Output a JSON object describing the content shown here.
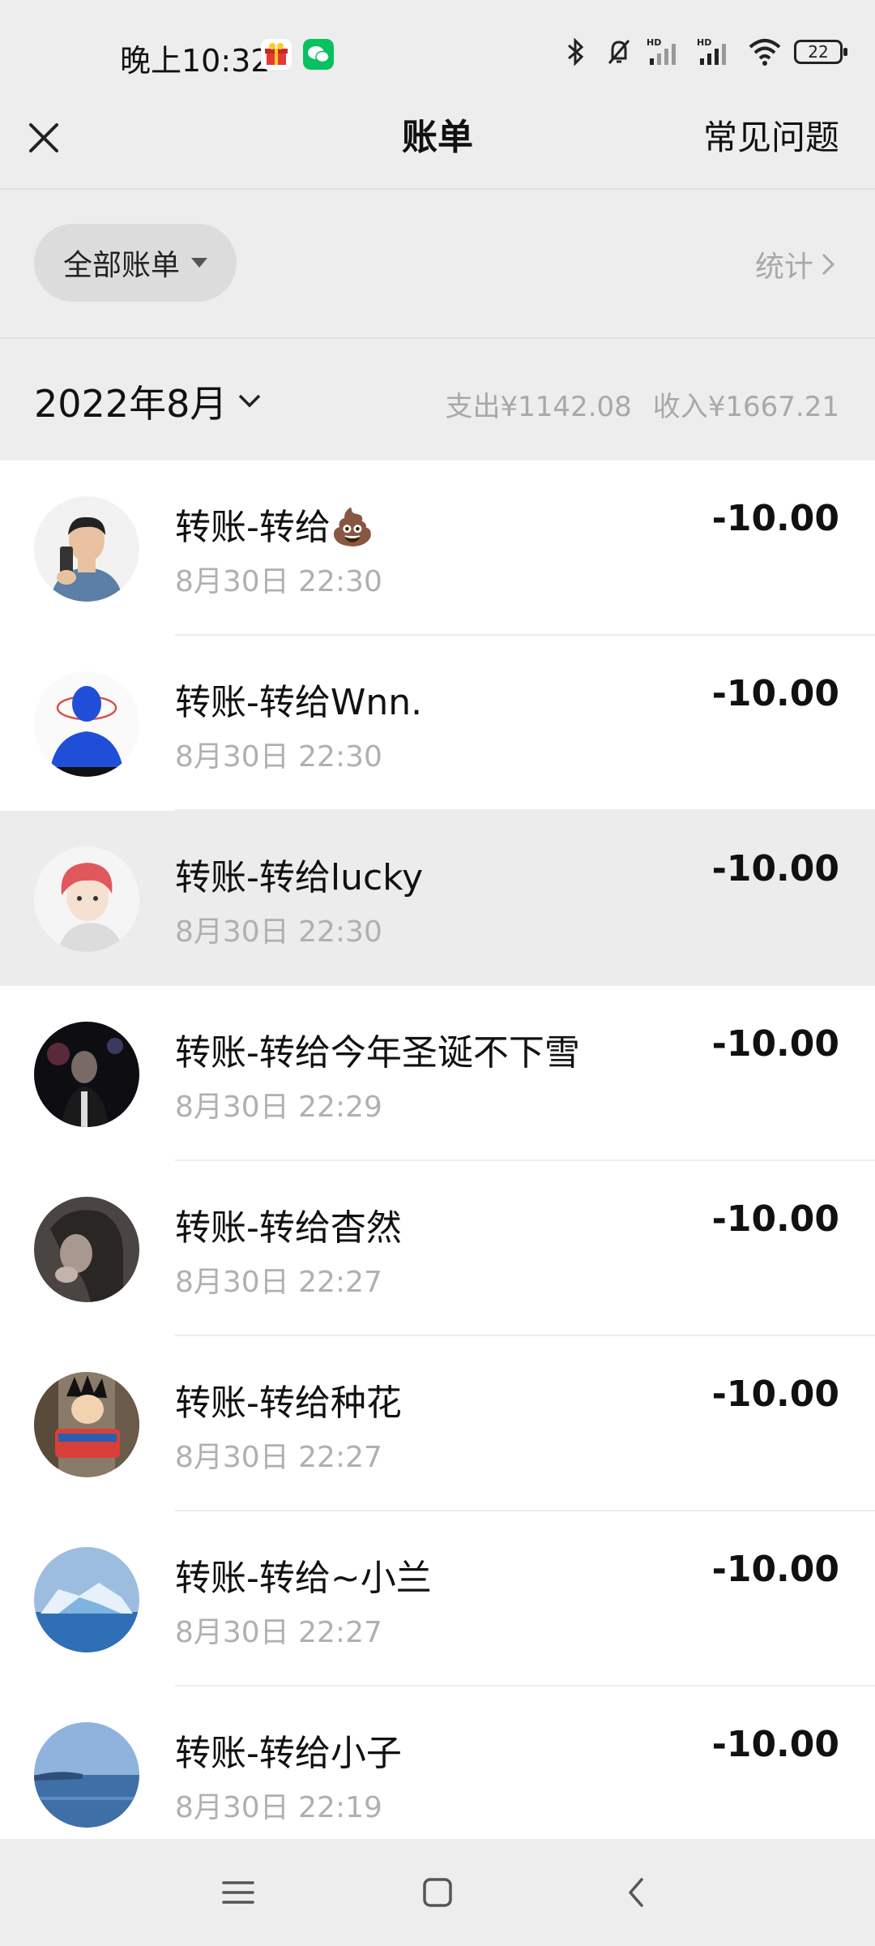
{
  "status_bar": {
    "time": "晚上10:32",
    "battery": "22",
    "icons": [
      "gift-app-icon",
      "wechat-app-icon",
      "bluetooth-icon",
      "mute-bell-icon",
      "signal-hd-icon",
      "signal-hd-icon",
      "wifi-icon",
      "battery-icon"
    ]
  },
  "header": {
    "title": "账单",
    "faq_label": "常见问题"
  },
  "filter": {
    "selected": "全部账单",
    "stats_label": "统计"
  },
  "month": {
    "label": "2022年8月",
    "expense": "支出¥1142.08",
    "income": "收入¥1667.21"
  },
  "transactions": [
    {
      "title": "转账-转给💩",
      "time": "8月30日 22:30",
      "amount": "-10.00"
    },
    {
      "title": "转账-转给Wnn.",
      "time": "8月30日 22:30",
      "amount": "-10.00"
    },
    {
      "title": "转账-转给lucky",
      "time": "8月30日 22:30",
      "amount": "-10.00"
    },
    {
      "title": "转账-转给今年圣诞不下雪",
      "time": "8月30日 22:29",
      "amount": "-10.00"
    },
    {
      "title": "转账-转给杳然",
      "time": "8月30日 22:27",
      "amount": "-10.00"
    },
    {
      "title": "转账-转给种花",
      "time": "8月30日 22:27",
      "amount": "-10.00"
    },
    {
      "title": "转账-转给~小兰",
      "time": "8月30日 22:27",
      "amount": "-10.00"
    },
    {
      "title": "转账-转给小子",
      "time": "8月30日 22:19",
      "amount": "-10.00"
    }
  ],
  "colors": {
    "background": "#ededed",
    "list_background": "#ffffff",
    "muted_text": "#a8a8a8",
    "wechat_green": "#07c160"
  }
}
